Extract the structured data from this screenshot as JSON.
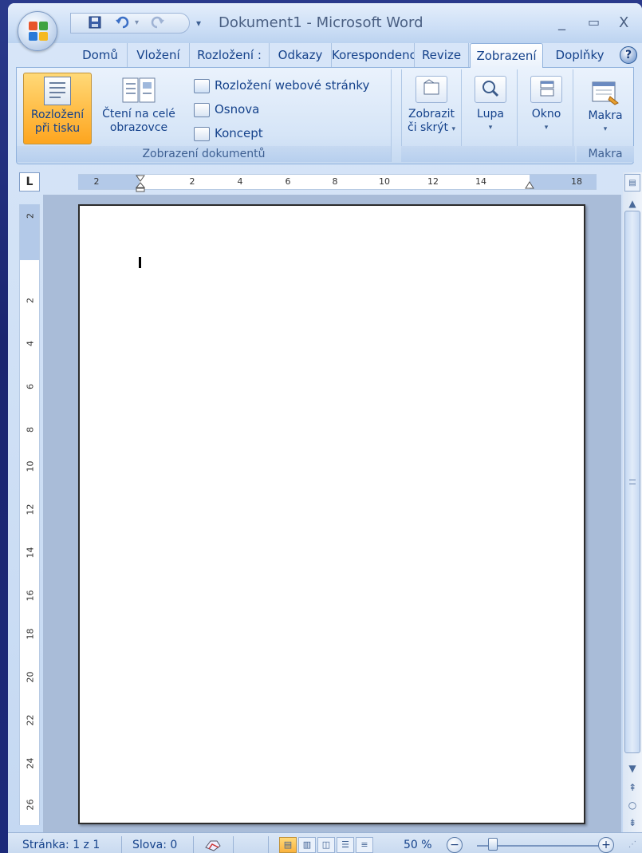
{
  "window": {
    "title": "Dokument1 - Microsoft Word",
    "controls": {
      "minimize": "_",
      "maximize": "▭",
      "close": "X"
    }
  },
  "quick_access": {
    "save_icon": "save-icon",
    "undo_icon": "undo-icon",
    "redo_icon": "redo-icon",
    "customize_arrow": "▾"
  },
  "tabs": [
    {
      "label": "Domů",
      "active": false
    },
    {
      "label": "Vložení",
      "active": false
    },
    {
      "label": "Rozložení :",
      "active": false
    },
    {
      "label": "Odkazy",
      "active": false
    },
    {
      "label": "Korespondenc",
      "active": false
    },
    {
      "label": "Revize",
      "active": false
    },
    {
      "label": "Zobrazení",
      "active": true
    },
    {
      "label": "Doplňky",
      "active": false
    }
  ],
  "help_label": "?",
  "ribbon": {
    "group_views": {
      "label": "Zobrazení dokumentů",
      "print_layout": {
        "line1": "Rozložení",
        "line2": "při tisku"
      },
      "full_screen": {
        "line1": "Čtení na celé",
        "line2": "obrazovce"
      },
      "web_layout": "Rozložení webové stránky",
      "outline": "Osnova",
      "draft": "Koncept"
    },
    "show_hide": {
      "line1": "Zobrazit",
      "line2": "či skrýt",
      "arrow": "▾"
    },
    "zoom": {
      "label": "Lupa",
      "arrow": "▾"
    },
    "window": {
      "label": "Okno",
      "arrow": "▾"
    },
    "macros": {
      "label": "Makra",
      "arrow": "▾",
      "group_label": "Makra"
    }
  },
  "ruler": {
    "corner": "L",
    "h_ticks": [
      "2",
      "2",
      "4",
      "6",
      "8",
      "10",
      "12",
      "14",
      "18"
    ],
    "v_ticks": [
      "2",
      "2",
      "4",
      "6",
      "8",
      "10",
      "12",
      "14",
      "16",
      "18",
      "20",
      "22",
      "24",
      "26"
    ]
  },
  "statusbar": {
    "page": "Stránka: 1 z 1",
    "words": "Slova: 0",
    "zoom_percent": "50 %",
    "zoom_minus": "−",
    "zoom_plus": "+",
    "zoom_level": 0.5
  },
  "colors": {
    "active_orange": "#fda51f",
    "ribbon_text": "#15428b",
    "desktop_blue": "#1a2570"
  }
}
